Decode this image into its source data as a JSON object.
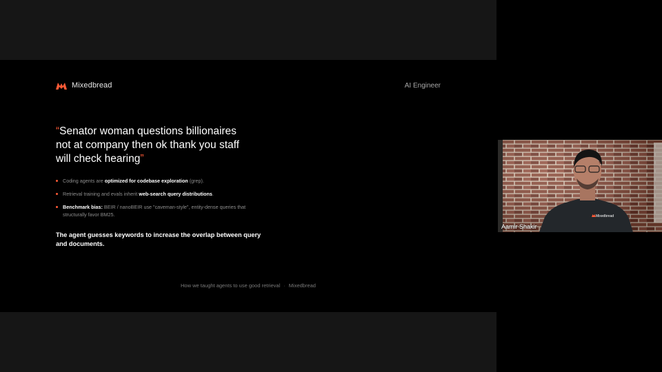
{
  "slide": {
    "brand": "Mixedbread",
    "event": "AI Engineer",
    "quote": {
      "open_mark": "“",
      "text": "Senator woman questions billionaires not at company then ok thank you staff will check hearing",
      "close_mark": "”"
    },
    "bullets": [
      {
        "pre": "Coding agents are ",
        "highlight": "optimized for codebase exploration",
        "post": " (grep)."
      },
      {
        "pre": "Retrieval training and evals inherit ",
        "highlight": "web-search query distributions",
        "post": "."
      },
      {
        "pre": "",
        "highlight": "Benchmark bias:",
        "post": " BEIR / nanoBEIR use \"caveman-style\", entity-dense queries that structurally favor BM25."
      }
    ],
    "conclusion": "The agent guesses keywords to increase the overlap between query and documents.",
    "footer": {
      "title": "How we taught agents to use good retrieval",
      "separator": "·",
      "company": "Mixedbread"
    }
  },
  "webcam": {
    "participant_name": "Aamir Shakir",
    "shirt_logo_text": "Mixedbread"
  },
  "colors": {
    "accent": "#ff5a36",
    "background": "#000000",
    "letterbox": "#161616"
  }
}
